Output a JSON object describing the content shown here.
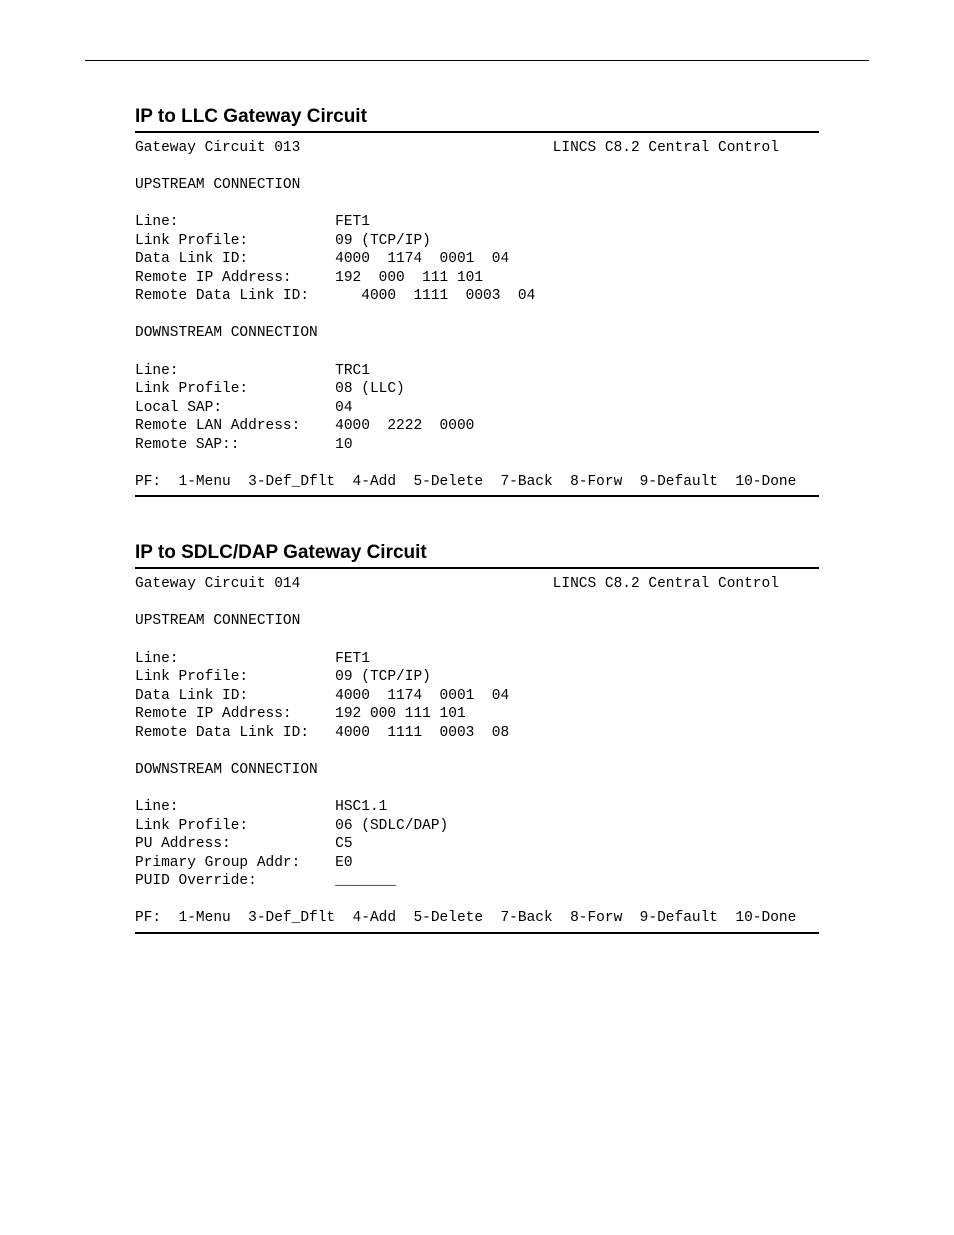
{
  "sections": [
    {
      "title": "IP to LLC Gateway Circuit",
      "term": "Gateway Circuit 013                             LINCS C8.2 Central Control\n\nUPSTREAM CONNECTION\n\nLine:                  FET1\nLink Profile:          09 (TCP/IP)\nData Link ID:          4000  1174  0001  04\nRemote IP Address:     192  000  111 101\nRemote Data Link ID:      4000  1111  0003  04\n\nDOWNSTREAM CONNECTION\n\nLine:                  TRC1\nLink Profile:          08 (LLC)\nLocal SAP:             04\nRemote LAN Address:    4000  2222  0000\nRemote SAP::           10\n\nPF:  1-Menu  3-Def_Dflt  4-Add  5-Delete  7-Back  8-Forw  9-Default  10-Done"
    },
    {
      "title": "IP to SDLC/DAP Gateway Circuit",
      "term": "Gateway Circuit 014                             LINCS C8.2 Central Control\n\nUPSTREAM CONNECTION\n\nLine:                  FET1\nLink Profile:          09 (TCP/IP)\nData Link ID:          4000  1174  0001  04\nRemote IP Address:     192 000 111 101\nRemote Data Link ID:   4000  1111  0003  08\n\nDOWNSTREAM CONNECTION\n\nLine:                  HSC1.1\nLink Profile:          06 (SDLC/DAP)\nPU Address:            C5\nPrimary Group Addr:    E0\nPUID Override:         _______\n\nPF:  1-Menu  3-Def_Dflt  4-Add  5-Delete  7-Back  8-Forw  9-Default  10-Done"
    }
  ]
}
